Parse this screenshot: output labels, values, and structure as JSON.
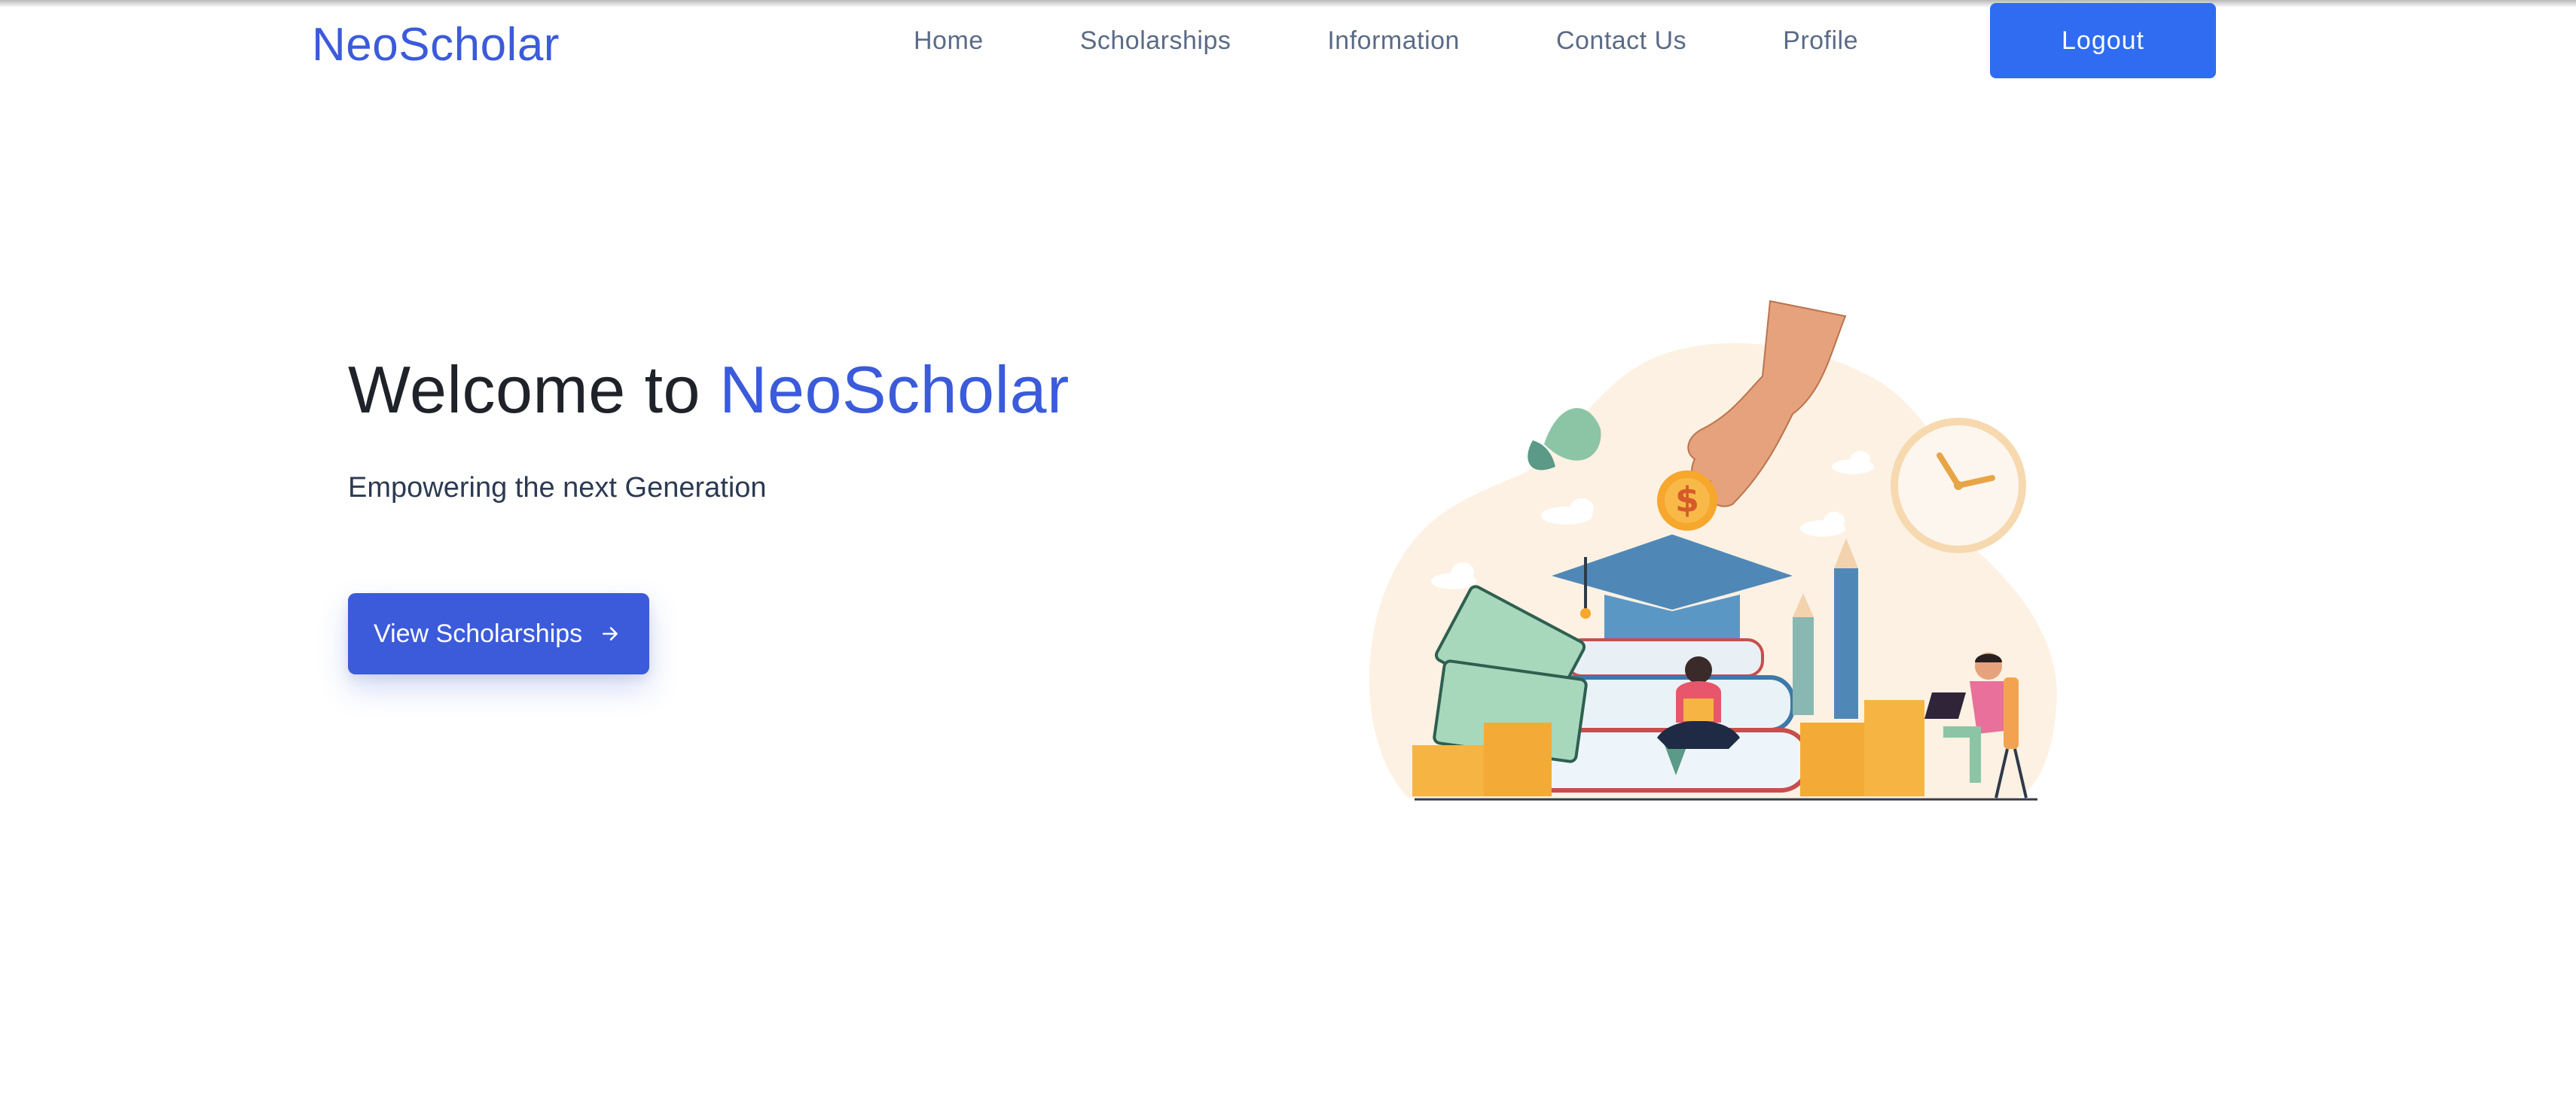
{
  "brand": {
    "name": "NeoScholar",
    "accent_color": "#3b5bdb"
  },
  "nav": {
    "items": [
      {
        "label": "Home"
      },
      {
        "label": "Scholarships"
      },
      {
        "label": "Information"
      },
      {
        "label": "Contact Us"
      },
      {
        "label": "Profile"
      }
    ],
    "logout_label": "Logout",
    "logout_color": "#2f6cf1"
  },
  "hero": {
    "title_prefix": "Welcome to",
    "title_highlight": "NeoScholar",
    "subtitle": "Empowering the next Generation",
    "cta_label": "View Scholarships",
    "cta_icon": "arrow-right-icon"
  },
  "illustration": {
    "description_icon": "scholarship-illustration"
  }
}
